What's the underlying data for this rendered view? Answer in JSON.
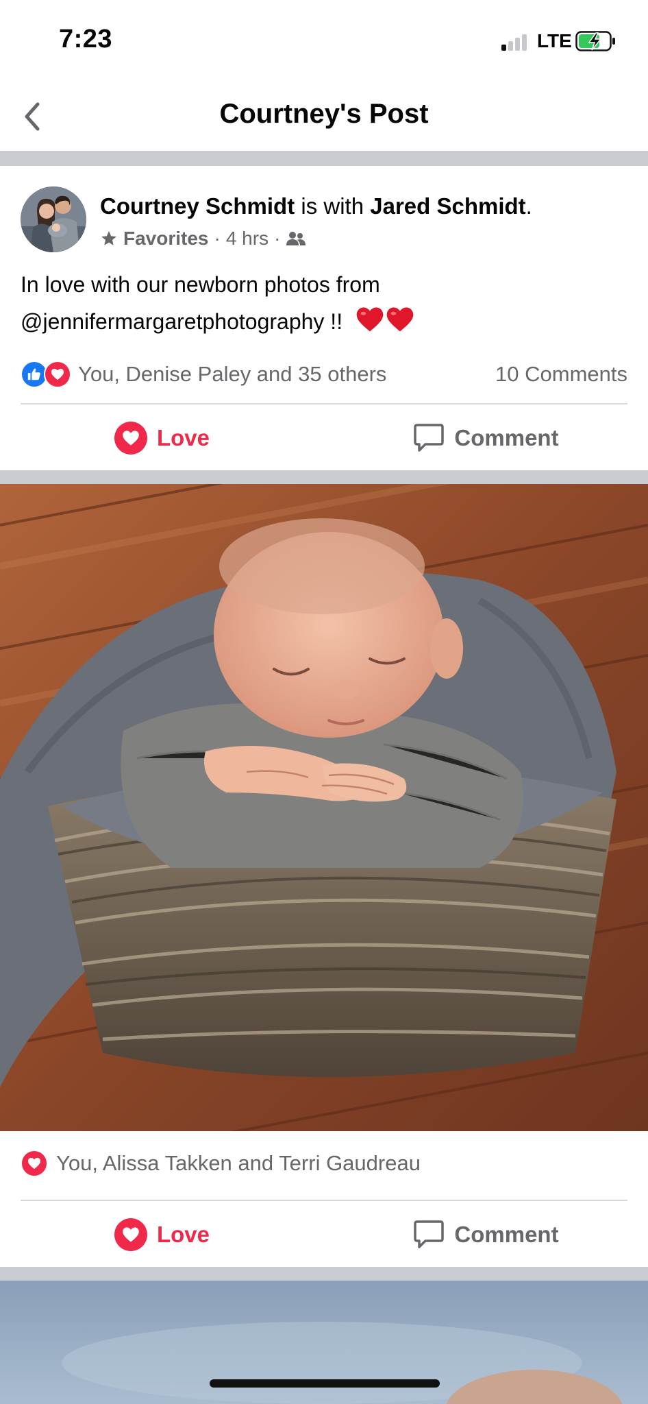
{
  "status_bar": {
    "time": "7:23",
    "network": "LTE",
    "signal_bars_active": 1,
    "signal_bars_total": 4
  },
  "nav": {
    "title": "Courtney's Post",
    "back_icon": "chevron-left-icon"
  },
  "post": {
    "author": "Courtney Schmidt",
    "with_text": " is with ",
    "tagged": "Jared Schmidt",
    "tagged_suffix": ".",
    "audience": "Favorites",
    "time": "4 hrs",
    "privacy_icon": "friends-icon",
    "separator": "·",
    "text_line1": "In love with our newborn photos from",
    "text_line2": "@jennifermargaretphotography  !!",
    "reactions_text": "You, Denise Paley and 35 others",
    "comments_count": "10 Comments",
    "actions": {
      "love_label": "Love",
      "comment_label": "Comment"
    }
  },
  "photo_1": {
    "reactions_text": "You, Alissa Takken and Terri Gaudreau",
    "actions": {
      "love_label": "Love",
      "comment_label": "Comment"
    }
  },
  "colors": {
    "love": "#f02849",
    "like": "#1877f2",
    "secondary_text": "#65676b",
    "separator": "#c9ccd1"
  }
}
